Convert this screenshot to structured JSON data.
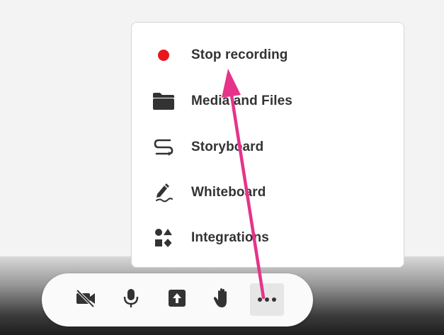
{
  "menu": {
    "items": [
      {
        "label": "Stop recording",
        "icon": "record-dot-icon"
      },
      {
        "label": "Media and Files",
        "icon": "folder-icon"
      },
      {
        "label": "Storyboard",
        "icon": "storyboard-icon"
      },
      {
        "label": "Whiteboard",
        "icon": "pen-icon"
      },
      {
        "label": "Integrations",
        "icon": "integrations-icon"
      }
    ]
  },
  "toolbar": {
    "buttons": [
      {
        "icon": "camera-off-icon"
      },
      {
        "icon": "microphone-icon"
      },
      {
        "icon": "share-screen-icon"
      },
      {
        "icon": "raise-hand-icon"
      },
      {
        "icon": "more-icon"
      }
    ]
  },
  "colors": {
    "record": "#e8171c",
    "annotation_arrow": "#e6338a",
    "icon": "#333333"
  }
}
